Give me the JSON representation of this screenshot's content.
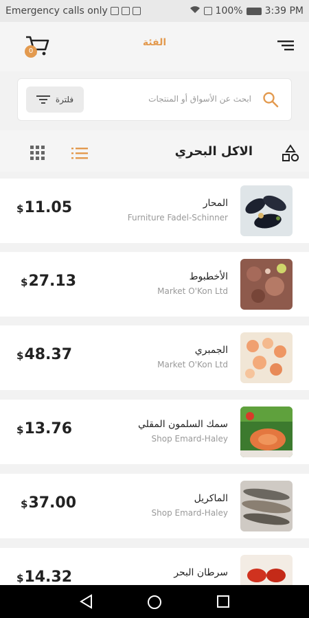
{
  "status_bar": {
    "left_text": "Emergency calls only",
    "battery": "100%",
    "time": "3:39 PM"
  },
  "header": {
    "title": "الفئة",
    "cart_count": "0"
  },
  "search": {
    "placeholder": "ابحث عن الأسواق أو المنتجات",
    "filter_label": "فلترة"
  },
  "section": {
    "title": "الاكل البحري"
  },
  "currency": "$",
  "colors": {
    "accent": "#e39a4f",
    "background": "#f2f2f2"
  },
  "products": [
    {
      "name": "المحار",
      "store": "Furniture Fadel-Schinner",
      "price": "11.05"
    },
    {
      "name": "الأخطبوط",
      "store": "Market O'Kon Ltd",
      "price": "27.13"
    },
    {
      "name": "الجمبري",
      "store": "Market O'Kon Ltd",
      "price": "48.37"
    },
    {
      "name": "سمك السلمون المقلي",
      "store": "Shop Emard-Haley",
      "price": "13.76"
    },
    {
      "name": "الماكريل",
      "store": "Shop Emard-Haley",
      "price": "37.00"
    },
    {
      "name": "سرطان البحر",
      "store": "",
      "price": "14.32"
    }
  ]
}
